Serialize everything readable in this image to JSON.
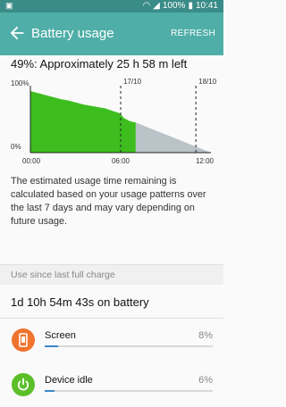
{
  "status": {
    "time": "10:41",
    "battery": "100%"
  },
  "appbar": {
    "title": "Battery usage",
    "refresh": "REFRESH"
  },
  "summary": "49%: Approximately 25 h 58 m left",
  "chart_data": {
    "type": "area",
    "x_labels": [
      "00:00",
      "06:00",
      "12:00"
    ],
    "y_labels": [
      "100%",
      "0%"
    ],
    "markers": [
      {
        "label": "17/10",
        "hour": 6
      },
      {
        "label": "18/10",
        "hour": 11
      }
    ],
    "series": [
      {
        "points": [
          [
            0,
            100
          ],
          [
            0,
            92
          ],
          [
            2,
            80
          ],
          [
            2.5,
            78
          ],
          [
            3,
            75
          ],
          [
            3.5,
            72
          ],
          [
            4,
            70
          ],
          [
            4.5,
            68
          ],
          [
            5,
            66
          ],
          [
            5.5,
            62
          ],
          [
            5.8,
            60
          ],
          [
            6,
            58
          ],
          [
            6.2,
            52
          ],
          [
            6.6,
            47
          ],
          [
            7,
            45
          ],
          [
            7,
            0
          ]
        ],
        "color": "#3dbe1e"
      },
      {
        "projected": [
          [
            7,
            45
          ],
          [
            12,
            0
          ]
        ],
        "color": "#b9c3c8"
      }
    ],
    "xlim": [
      0,
      12
    ],
    "ylim": [
      0,
      100
    ]
  },
  "note": "The estimated usage time remaining is calculated based on your usage patterns over the last 7 days and may vary depending on future usage.",
  "section_label": "Use since last full charge",
  "total": "1d 10h 54m 43s on battery",
  "items": [
    {
      "name": "Screen",
      "pct": "8%",
      "fraction": 0.08,
      "icon": "screen-icon",
      "color": "#f0742d"
    },
    {
      "name": "Device idle",
      "pct": "6%",
      "fraction": 0.06,
      "icon": "power-icon",
      "color": "#5cbf2a"
    }
  ]
}
